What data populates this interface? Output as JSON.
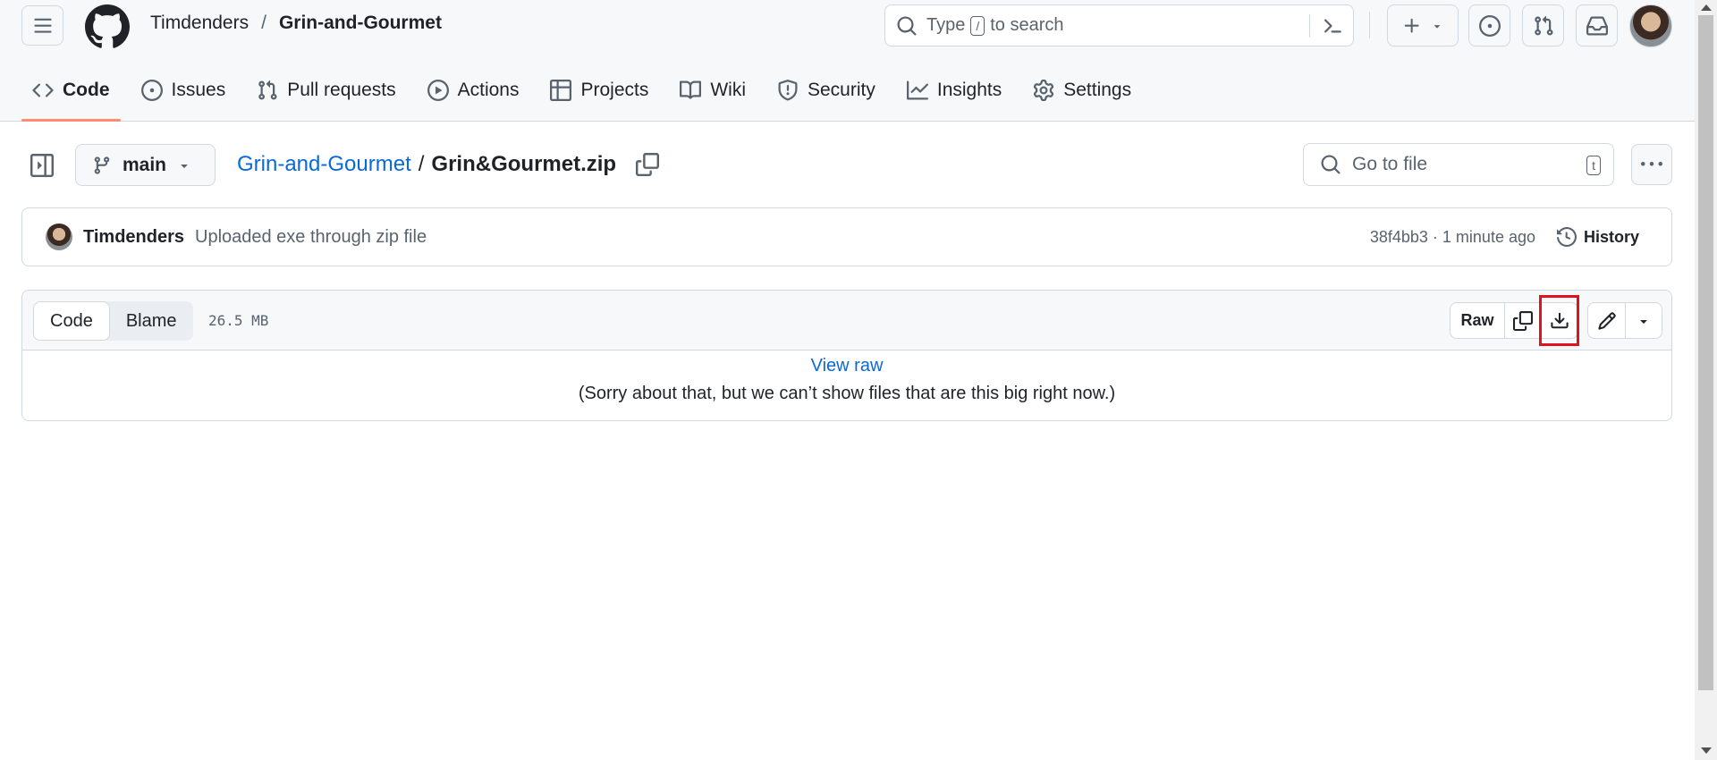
{
  "header": {
    "owner": "Timdenders",
    "separator": "/",
    "repo": "Grin-and-Gourmet",
    "search": {
      "prefix": "Type",
      "key": "/",
      "suffix": "to search"
    }
  },
  "nav": {
    "code": "Code",
    "issues": "Issues",
    "pull_requests": "Pull requests",
    "actions": "Actions",
    "projects": "Projects",
    "wiki": "Wiki",
    "security": "Security",
    "insights": "Insights",
    "settings": "Settings"
  },
  "file_header": {
    "branch": "main",
    "repo_link": "Grin-and-Gourmet",
    "separator": "/",
    "filename": "Grin&Gourmet.zip",
    "goto_placeholder": "Go to file",
    "goto_key": "t"
  },
  "commit": {
    "author": "Timdenders",
    "message": "Uploaded exe through zip file",
    "meta": "38f4bb3 · 1 minute ago",
    "history": "History"
  },
  "file": {
    "tab_code": "Code",
    "tab_blame": "Blame",
    "size": "26.5 MB",
    "raw": "Raw",
    "view_raw": "View raw",
    "too_big": "(Sorry about that, but we can’t show files that are this big right now.)"
  },
  "colors": {
    "link": "#0969da",
    "active_tab_underline": "#fd8c73",
    "highlight": "#e0131c"
  }
}
